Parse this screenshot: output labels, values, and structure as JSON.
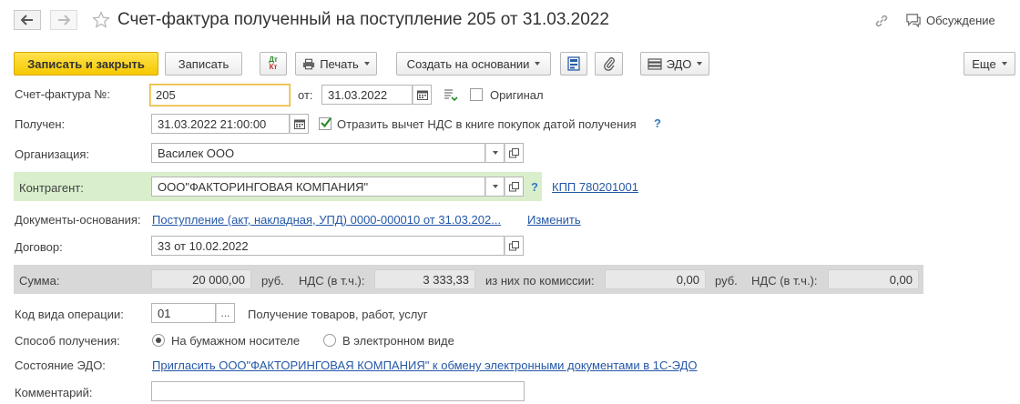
{
  "header": {
    "back_icon": "arrow-left-icon",
    "forward_icon": "arrow-right-icon",
    "favorite_icon": "star-icon",
    "title": "Счет-фактура полученный на поступление 205 от 31.03.2022",
    "link_icon": "link-icon",
    "discussion_label": "Обсуждение"
  },
  "toolbar": {
    "save_close": "Записать и закрыть",
    "save": "Записать",
    "dtkt_top": "Дт",
    "dtkt_bottom": "Кт",
    "print": "Печать",
    "create_based": "Создать на основании",
    "edo": "ЭДО",
    "more": "Еще"
  },
  "form": {
    "invoice_no_label": "Счет-фактура №:",
    "invoice_no_value": "205",
    "date_label": "от:",
    "date_value": "31.03.2022",
    "original_label": "Оригинал",
    "received_label": "Получен:",
    "received_value": "31.03.2022 21:00:00",
    "vat_deduction_label": "Отразить вычет НДС в книге покупок датой получения",
    "help_mark": "?",
    "organization_label": "Организация:",
    "organization_value": "Василек ООО",
    "counterparty_label": "Контрагент:",
    "counterparty_value": "ООО\"ФАКТОРИНГОВАЯ КОМПАНИЯ\"",
    "kpp_link": "КПП 780201001",
    "basis_docs_label": "Документы-основания:",
    "basis_docs_link": "Поступление (акт, накладная, УПД) 0000-000010 от 31.03.202...",
    "change_link": "Изменить",
    "contract_label": "Договор:",
    "contract_value": "33 от 10.02.2022",
    "sum_label": "Сумма:",
    "sum_value": "20 000,00",
    "currency": "руб.",
    "vat_incl_label": "НДС (в т.ч.):",
    "vat_value": "3 333,33",
    "commission_label": "из них по комиссии:",
    "commission_value": "0,00",
    "commission_vat_value": "0,00",
    "op_code_label": "Код вида операции:",
    "op_code_value": "01",
    "op_code_btn": "...",
    "op_code_desc": "Получение товаров, работ, услуг",
    "receipt_method_label": "Способ получения:",
    "receipt_paper": "На бумажном носителе",
    "receipt_electronic": "В электронном виде",
    "edo_state_label": "Состояние ЭДО:",
    "edo_invite_link": "Пригласить ООО\"ФАКТОРИНГОВАЯ КОМПАНИЯ\" к обмену электронными документами в 1С-ЭДО",
    "comment_label": "Комментарий:",
    "comment_value": ""
  }
}
